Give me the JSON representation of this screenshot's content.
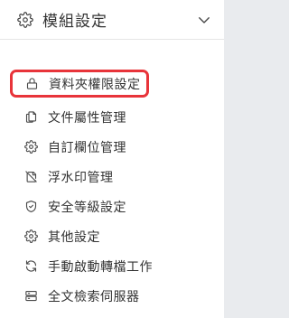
{
  "header": {
    "title": "模組設定",
    "icon": "gear-icon",
    "chevron": "chevron-down-icon"
  },
  "menu": {
    "items": [
      {
        "label": "資料夾權限設定",
        "icon": "lock-icon",
        "selected": true
      },
      {
        "label": "文件屬性管理",
        "icon": "document-copy-icon"
      },
      {
        "label": "自訂欄位管理",
        "icon": "gear-icon"
      },
      {
        "label": "浮水印管理",
        "icon": "watermark-off-icon"
      },
      {
        "label": "安全等級設定",
        "icon": "shield-icon"
      },
      {
        "label": "其他設定",
        "icon": "gear-icon"
      },
      {
        "label": "手動啟動轉檔工作",
        "icon": "sync-icon"
      },
      {
        "label": "全文檢索伺服器",
        "icon": "server-icon"
      }
    ]
  },
  "colors": {
    "highlight_border": "#e8343a",
    "text": "#333333",
    "background": "#ffffff"
  }
}
